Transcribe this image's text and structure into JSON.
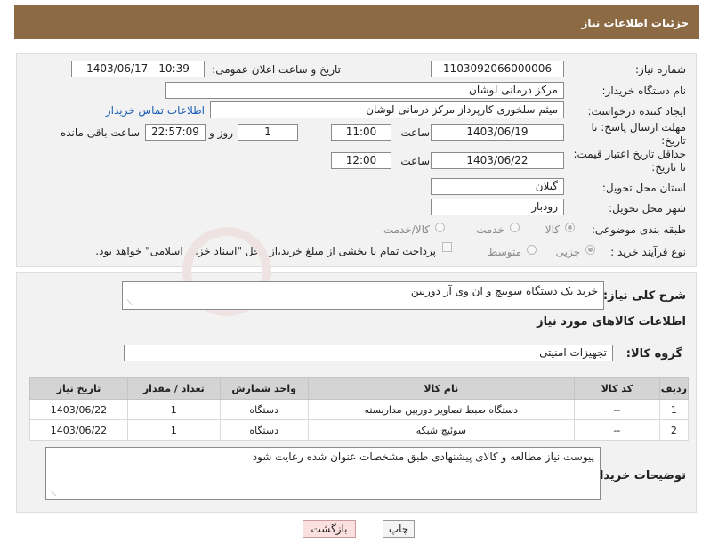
{
  "header": {
    "title": "جزئیات اطلاعات نیاز"
  },
  "form": {
    "need_number_label": "شماره نیاز:",
    "need_number": "1103092066000006",
    "announce_label": "تاریخ و ساعت اعلان عمومی:",
    "announce_value": "1403/06/17 - 10:39",
    "buyer_org_label": "نام دستگاه خریدار:",
    "buyer_org": "مرکز درمانی لوشان",
    "creator_label": "ایجاد کننده درخواست:",
    "creator": "میثم سلخوری کارپرداز مرکز درمانی لوشان",
    "contact_link": "اطلاعات تماس خریدار",
    "reply_deadline_label": "مهلت ارسال پاسخ: تا تاریخ:",
    "reply_date": "1403/06/19",
    "time_label": "ساعت",
    "reply_time": "11:00",
    "days_value": "1",
    "days_label": "روز و",
    "remaining_time": "22:57:09",
    "remaining_label": "ساعت باقی مانده",
    "price_validity_label": "حداقل تاریخ اعتبار قیمت: تا تاریخ:",
    "price_date": "1403/06/22",
    "price_time": "12:00",
    "province_label": "استان محل تحویل:",
    "province": "گیلان",
    "city_label": "شهر محل تحویل:",
    "city": "رودبار",
    "category_label": "طبقه بندی موضوعی:",
    "category_options": [
      "کالا",
      "خدمت",
      "کالا/خدمت"
    ],
    "purchase_type_label": "نوع فرآیند خرید :",
    "purchase_options": [
      "جزیی",
      "متوسط"
    ],
    "payment_note": "پرداخت تمام یا بخشی از مبلغ خرید،از محل \"اسناد خزانه اسلامی\" خواهد بود."
  },
  "details": {
    "desc_label": "شرح کلی نیاز:",
    "desc": "خرید یک دستگاه سوییچ و ان وی آر دوربین",
    "goods_info_title": "اطلاعات کالاهای مورد نیاز",
    "goods_group_label": "گروه کالا:",
    "goods_group": "تجهیزات امنیتی",
    "table": {
      "headers": [
        "ردیف",
        "کد کالا",
        "نام کالا",
        "واحد شمارش",
        "تعداد / مقدار",
        "تاریخ نیاز"
      ],
      "rows": [
        [
          "1",
          "--",
          "دستگاه ضبط تصاویر دوربین مداربسته",
          "دستگاه",
          "1",
          "1403/06/22"
        ],
        [
          "2",
          "--",
          "سوئیچ شبکه",
          "دستگاه",
          "1",
          "1403/06/22"
        ]
      ]
    },
    "buyer_notes_label": "توضیحات خریدار:",
    "buyer_notes": "پیوست نیاز مطالعه و کالای پیشنهادی طبق مشخصات عنوان شده رعایت شود"
  },
  "buttons": {
    "print": "چاپ",
    "back": "بازگشت"
  }
}
